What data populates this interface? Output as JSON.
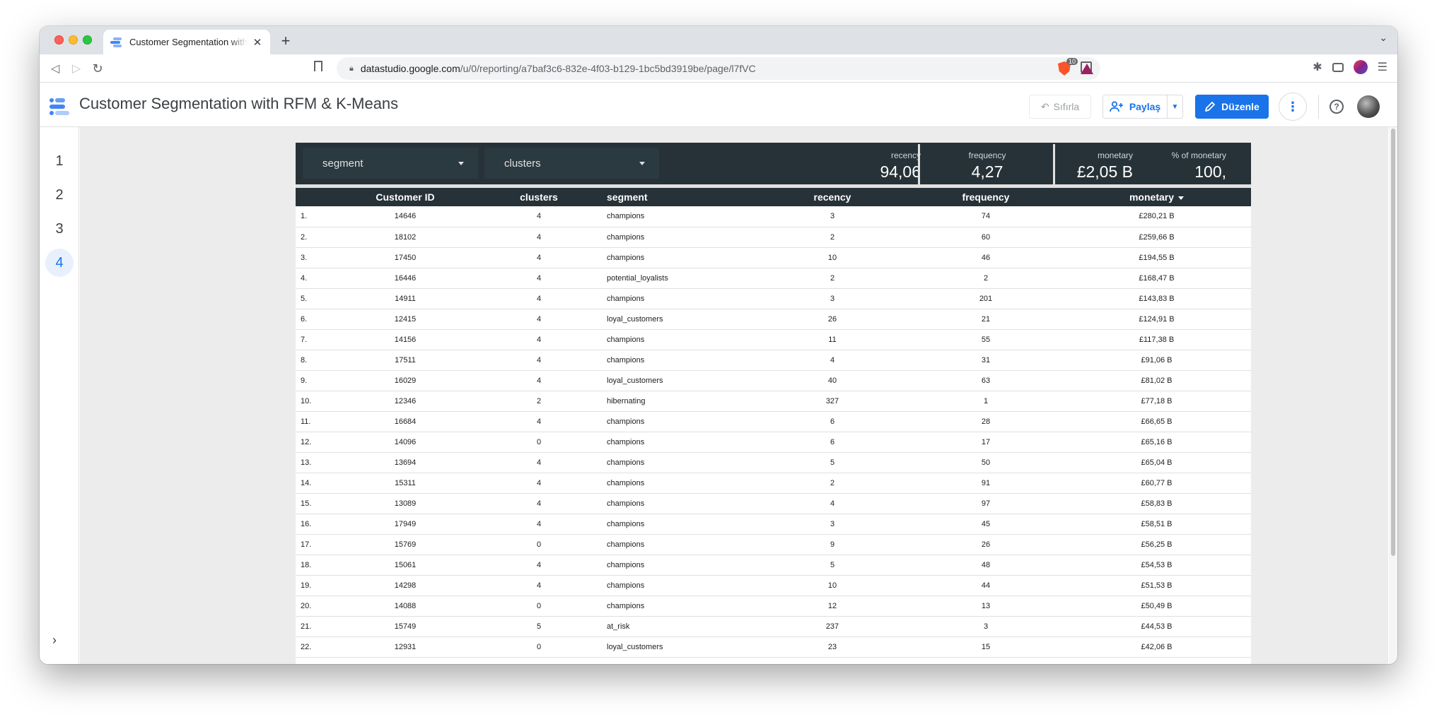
{
  "browser": {
    "tab_title": "Customer Segmentation with RFM & K-Means",
    "url_host": "datastudio.google.com",
    "url_path": "/u/0/reporting/a7baf3c6-832e-4f03-b129-1bc5bd3919be/page/l7fVC",
    "shields_badge": "10"
  },
  "app": {
    "title": "Customer Segmentation with RFM & K-Means",
    "reset_label": "Sıfırla",
    "share_label": "Paylaş",
    "edit_label": "Düzenle"
  },
  "pages": [
    "1",
    "2",
    "3",
    "4"
  ],
  "active_page": "4",
  "filters": [
    {
      "label": "segment"
    },
    {
      "label": "clusters"
    }
  ],
  "kpis": {
    "recency": {
      "label": "recency",
      "value": "94,06"
    },
    "frequency": {
      "label": "frequency",
      "value": "4,27"
    },
    "monetary": {
      "label": "monetary",
      "value": "£2,05 B"
    },
    "pct_monetary": {
      "label": "% of monetary",
      "value": "100,"
    }
  },
  "table": {
    "headers": [
      "",
      "Customer ID",
      "clusters",
      "segment",
      "recency",
      "frequency",
      "monetary"
    ],
    "rows": [
      [
        "1.",
        "14646",
        "4",
        "champions",
        "3",
        "74",
        "£280,21 B"
      ],
      [
        "2.",
        "18102",
        "4",
        "champions",
        "2",
        "60",
        "£259,66 B"
      ],
      [
        "3.",
        "17450",
        "4",
        "champions",
        "10",
        "46",
        "£194,55 B"
      ],
      [
        "4.",
        "16446",
        "4",
        "potential_loyalists",
        "2",
        "2",
        "£168,47 B"
      ],
      [
        "5.",
        "14911",
        "4",
        "champions",
        "3",
        "201",
        "£143,83 B"
      ],
      [
        "6.",
        "12415",
        "4",
        "loyal_customers",
        "26",
        "21",
        "£124,91 B"
      ],
      [
        "7.",
        "14156",
        "4",
        "champions",
        "11",
        "55",
        "£117,38 B"
      ],
      [
        "8.",
        "17511",
        "4",
        "champions",
        "4",
        "31",
        "£91,06 B"
      ],
      [
        "9.",
        "16029",
        "4",
        "loyal_customers",
        "40",
        "63",
        "£81,02 B"
      ],
      [
        "10.",
        "12346",
        "2",
        "hibernating",
        "327",
        "1",
        "£77,18 B"
      ],
      [
        "11.",
        "16684",
        "4",
        "champions",
        "6",
        "28",
        "£66,65 B"
      ],
      [
        "12.",
        "14096",
        "0",
        "champions",
        "6",
        "17",
        "£65,16 B"
      ],
      [
        "13.",
        "13694",
        "4",
        "champions",
        "5",
        "50",
        "£65,04 B"
      ],
      [
        "14.",
        "15311",
        "4",
        "champions",
        "2",
        "91",
        "£60,77 B"
      ],
      [
        "15.",
        "13089",
        "4",
        "champions",
        "4",
        "97",
        "£58,83 B"
      ],
      [
        "16.",
        "17949",
        "4",
        "champions",
        "3",
        "45",
        "£58,51 B"
      ],
      [
        "17.",
        "15769",
        "0",
        "champions",
        "9",
        "26",
        "£56,25 B"
      ],
      [
        "18.",
        "15061",
        "4",
        "champions",
        "5",
        "48",
        "£54,53 B"
      ],
      [
        "19.",
        "14298",
        "4",
        "champions",
        "10",
        "44",
        "£51,53 B"
      ],
      [
        "20.",
        "14088",
        "0",
        "champions",
        "12",
        "13",
        "£50,49 B"
      ],
      [
        "21.",
        "15749",
        "5",
        "at_risk",
        "237",
        "3",
        "£44,53 B"
      ],
      [
        "22.",
        "12931",
        "0",
        "loyal_customers",
        "23",
        "15",
        "£42,06 B"
      ]
    ]
  }
}
